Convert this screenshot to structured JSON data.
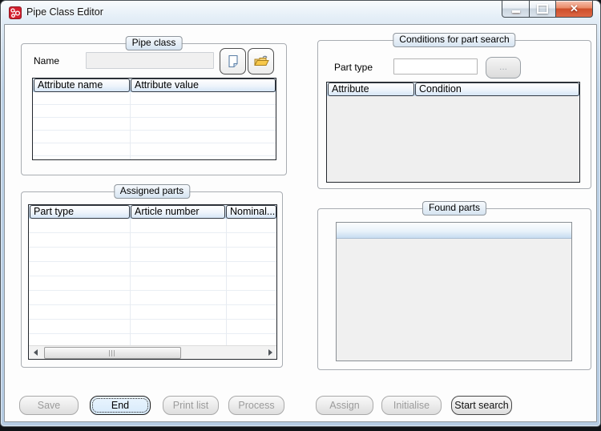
{
  "window": {
    "title": "Pipe Class Editor",
    "controls": {
      "minimize": "minimize",
      "maximize": "maximize",
      "close": "close"
    }
  },
  "pipe_class": {
    "title": "Pipe class",
    "name_label": "Name",
    "name_value": "",
    "table": {
      "columns": [
        "Attribute name",
        "Attribute value"
      ],
      "rows": []
    }
  },
  "conditions": {
    "title": "Conditions for part search",
    "part_type_label": "Part type",
    "part_type_value": "",
    "browse_label": "...",
    "table": {
      "columns": [
        "Attribute",
        "Condition"
      ],
      "rows": []
    }
  },
  "assigned_parts": {
    "title": "Assigned parts",
    "table": {
      "columns": [
        "Part type",
        "Article number",
        "Nominal..."
      ],
      "rows": []
    }
  },
  "found_parts": {
    "title": "Found parts",
    "rows": []
  },
  "buttons": {
    "save": "Save",
    "end": "End",
    "print_list": "Print list",
    "process": "Process",
    "assign": "Assign",
    "initialise": "Initialise",
    "start_search": "Start search"
  },
  "colors": {
    "titlebar_glass": "#bdd2e8",
    "close_button_red": "#cd4f2b",
    "header_gradient_blue": "#d6e6f7",
    "focused_button_bg": "#d7eafb",
    "disabled_field_bg": "#f0f0f0",
    "app_icon_red": "#d3202f"
  }
}
